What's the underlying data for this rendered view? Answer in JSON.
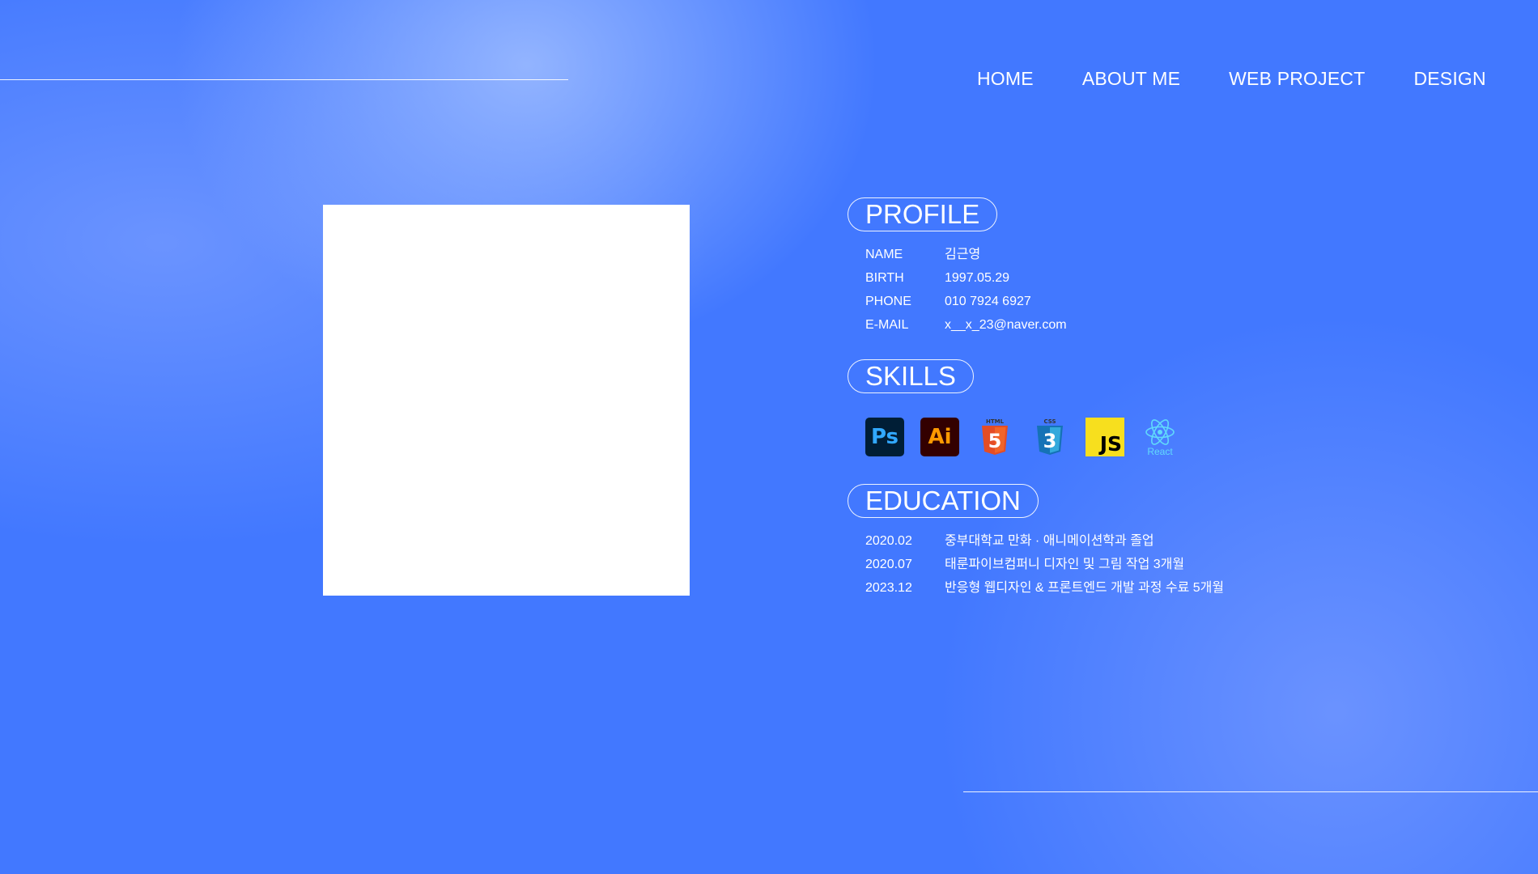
{
  "nav": {
    "items": [
      "HOME",
      "ABOUT ME",
      "WEB PROJECT",
      "DESIGN"
    ]
  },
  "profile": {
    "title": "PROFILE",
    "rows": [
      {
        "label": "NAME",
        "value": "김근영"
      },
      {
        "label": "BIRTH",
        "value": "1997.05.29"
      },
      {
        "label": "PHONE",
        "value": "010 7924 6927"
      },
      {
        "label": "E-MAIL",
        "value": "x__x_23@naver.com"
      }
    ]
  },
  "skills": {
    "title": "SKILLS",
    "icons": [
      {
        "name": "photoshop-icon",
        "text": "Ps",
        "bg": "#001e36",
        "fg": "#31a8ff"
      },
      {
        "name": "illustrator-icon",
        "text": "Ai",
        "bg": "#330000",
        "fg": "#ff9a00"
      },
      {
        "name": "html5-icon",
        "badge": "HTML",
        "text": "5",
        "fg": "#e44d26"
      },
      {
        "name": "css3-icon",
        "badge": "CSS",
        "text": "3",
        "fg": "#1572b6"
      },
      {
        "name": "javascript-icon",
        "text": "JS",
        "bg": "#f7df1e",
        "fg": "#000000"
      },
      {
        "name": "react-icon",
        "text": "React",
        "fg": "#61dafb"
      }
    ]
  },
  "education": {
    "title": "EDUCATION",
    "rows": [
      {
        "date": "2020.02",
        "desc": "중부대학교 만화 · 애니메이션학과 졸업"
      },
      {
        "date": "2020.07",
        "desc": "태룬파이브컴퍼니 디자인 및 그림 작업 3개월"
      },
      {
        "date": "2023.12",
        "desc": "반응형 웹디자인 & 프론트엔드 개발 과정 수료 5개월"
      }
    ]
  },
  "colors": {
    "background": "#4278ff",
    "text": "#ffffff",
    "photo": "#ffffff"
  }
}
